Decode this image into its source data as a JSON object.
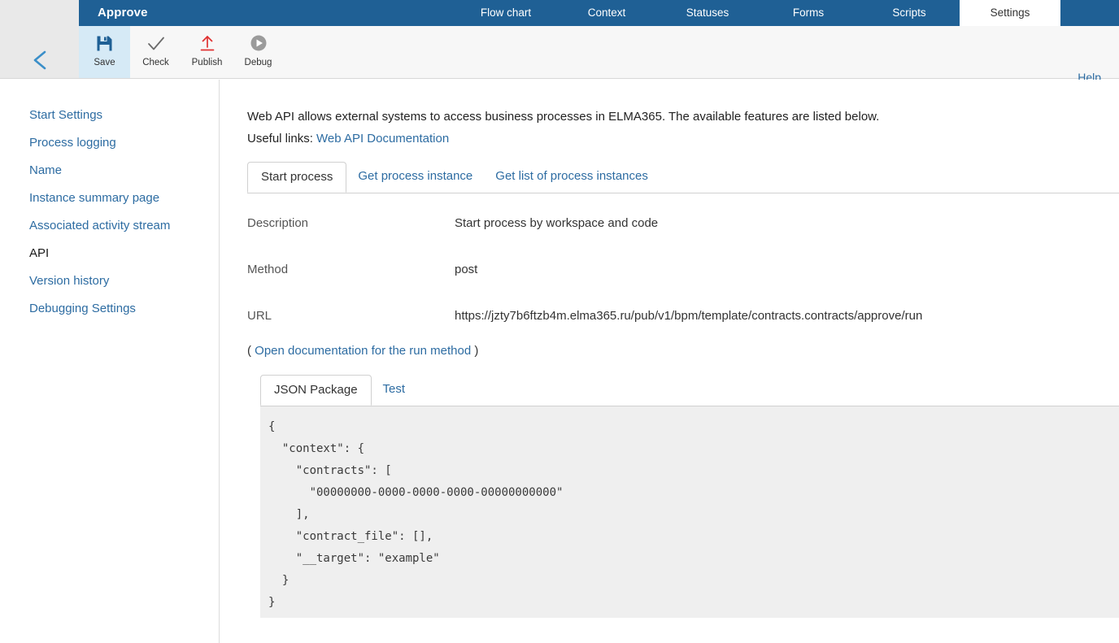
{
  "header": {
    "title": "Approve",
    "tabs": [
      {
        "label": "Flow chart",
        "active": false
      },
      {
        "label": "Context",
        "active": false
      },
      {
        "label": "Statuses",
        "active": false
      },
      {
        "label": "Forms",
        "active": false
      },
      {
        "label": "Scripts",
        "active": false
      },
      {
        "label": "Settings",
        "active": true
      }
    ],
    "accent_color": "#1f6095"
  },
  "toolbar": {
    "back_icon": "chevron-left-icon",
    "buttons": [
      {
        "label": "Save",
        "icon": "save-floppy-icon",
        "active": true
      },
      {
        "label": "Check",
        "icon": "checkmark-icon",
        "active": false
      },
      {
        "label": "Publish",
        "icon": "upload-arrow-icon",
        "active": false
      },
      {
        "label": "Debug",
        "icon": "play-circle-icon",
        "active": false
      }
    ],
    "help_label": "Help",
    "active_bg": "#d6eaf6"
  },
  "sidebar": {
    "items": [
      {
        "label": "Start Settings",
        "active": false
      },
      {
        "label": "Process logging",
        "active": false
      },
      {
        "label": "Name",
        "active": false
      },
      {
        "label": "Instance summary page",
        "active": false
      },
      {
        "label": "Associated activity stream",
        "active": false
      },
      {
        "label": "API",
        "active": true
      },
      {
        "label": "Version history",
        "active": false
      },
      {
        "label": "Debugging Settings",
        "active": false
      }
    ],
    "link_color": "#2d6ca2"
  },
  "main": {
    "intro_line1": "Web API allows external systems to access business processes in ELMA365. The available features are listed below.",
    "intro_prefix": "Useful links: ",
    "intro_link": "Web API Documentation",
    "method_tabs": [
      {
        "label": "Start process",
        "active": true
      },
      {
        "label": "Get process instance",
        "active": false
      },
      {
        "label": "Get list of process instances",
        "active": false
      }
    ],
    "fields": [
      {
        "label": "Description",
        "value": "Start process by workspace and code"
      },
      {
        "label": "Method",
        "value": "post"
      },
      {
        "label": "URL",
        "value": "https://jzty7b6ftzb4m.elma365.ru/pub/v1/bpm/template/contracts.contracts/approve/run"
      }
    ],
    "doc_open_paren": "( ",
    "doc_link": "Open documentation for the run method",
    "doc_close_paren": " )",
    "json_tabs": [
      {
        "label": "JSON Package",
        "active": true
      },
      {
        "label": "Test",
        "active": false
      }
    ],
    "json_package": "{\n  \"context\": {\n    \"contracts\": [\n      \"00000000-0000-0000-0000-00000000000\"\n    ],\n    \"contract_file\": [],\n    \"__target\": \"example\"\n  }\n}"
  }
}
